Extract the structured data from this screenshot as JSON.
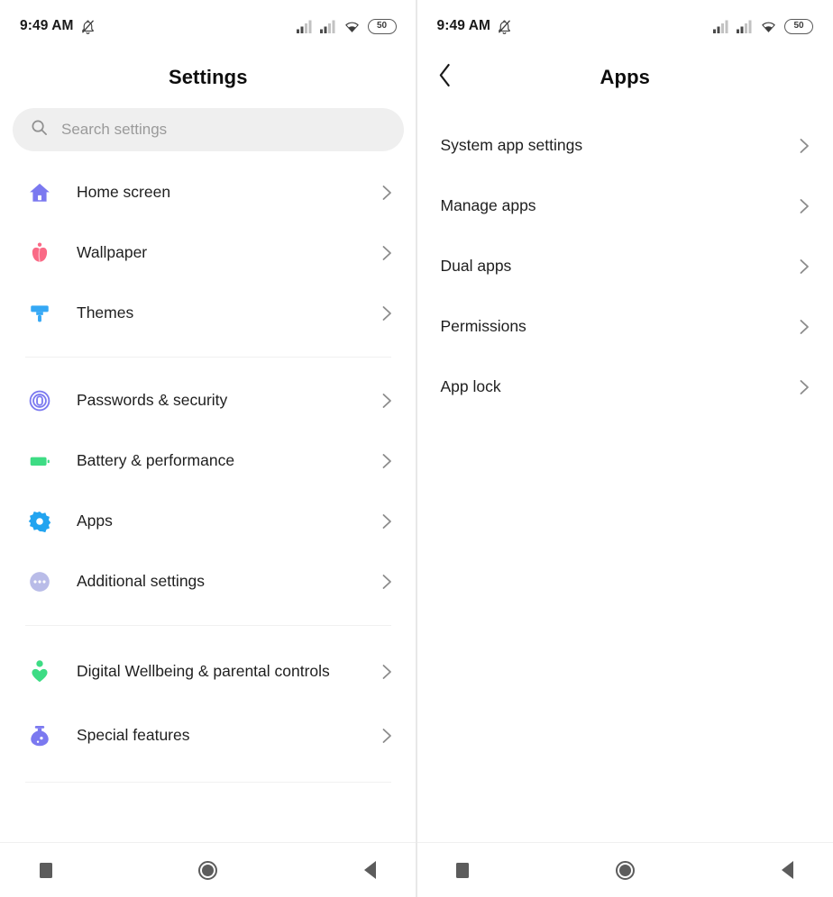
{
  "statusbar": {
    "time": "9:49 AM",
    "mute_icon": "bell-muted-icon",
    "signal1_icon": "signal-bars-icon",
    "signal2_icon": "signal-bars-icon",
    "wifi_icon": "wifi-icon",
    "battery_level": "50"
  },
  "left_screen": {
    "title": "Settings",
    "search": {
      "icon": "search-icon",
      "placeholder": "Search settings",
      "value": ""
    },
    "groups": [
      {
        "items": [
          {
            "label": "Home screen",
            "icon": "house-icon",
            "icon_color": "#7b79f0",
            "chevron": "chevron-right-icon"
          },
          {
            "label": "Wallpaper",
            "icon": "tulip-flower-icon",
            "icon_color": "#fa6a86",
            "chevron": "chevron-right-icon"
          },
          {
            "label": "Themes",
            "icon": "paintbrush-icon",
            "icon_color": "#35a8f5",
            "chevron": "chevron-right-icon"
          }
        ]
      },
      {
        "items": [
          {
            "label": "Passwords & security",
            "icon": "fingerprint-icon",
            "icon_color": "#7b79f0",
            "chevron": "chevron-right-icon"
          },
          {
            "label": "Battery & performance",
            "icon": "battery-icon",
            "icon_color": "#3ddc84",
            "chevron": "chevron-right-icon"
          },
          {
            "label": "Apps",
            "icon": "gear-icon",
            "icon_color": "#22a4f0",
            "chevron": "chevron-right-icon"
          },
          {
            "label": "Additional settings",
            "icon": "more-dots-circle-icon",
            "icon_color": "#b9bce8",
            "chevron": "chevron-right-icon"
          }
        ]
      },
      {
        "items": [
          {
            "label": "Digital Wellbeing & parental controls",
            "icon": "person-heart-icon",
            "icon_color": "#3ddc84",
            "chevron": "chevron-right-icon"
          },
          {
            "label": "Special features",
            "icon": "flask-icon",
            "icon_color": "#7b79f0",
            "chevron": "chevron-right-icon"
          }
        ]
      }
    ]
  },
  "right_screen": {
    "back_icon": "chevron-left-icon",
    "title": "Apps",
    "items": [
      {
        "label": "System app settings",
        "chevron": "chevron-right-icon"
      },
      {
        "label": "Manage apps",
        "chevron": "chevron-right-icon"
      },
      {
        "label": "Dual apps",
        "chevron": "chevron-right-icon"
      },
      {
        "label": "Permissions",
        "chevron": "chevron-right-icon"
      },
      {
        "label": "App lock",
        "chevron": "chevron-right-icon"
      }
    ]
  },
  "navbar": {
    "recents_icon": "square-recents-icon",
    "home_icon": "circle-home-icon",
    "back_icon": "triangle-back-icon"
  },
  "colors": {
    "search_bg": "#efefef",
    "text_primary": "#1f1f1f",
    "text_muted": "#9a9a9a",
    "chevron": "#8c8c8c",
    "divider": "#f1f1f1"
  }
}
